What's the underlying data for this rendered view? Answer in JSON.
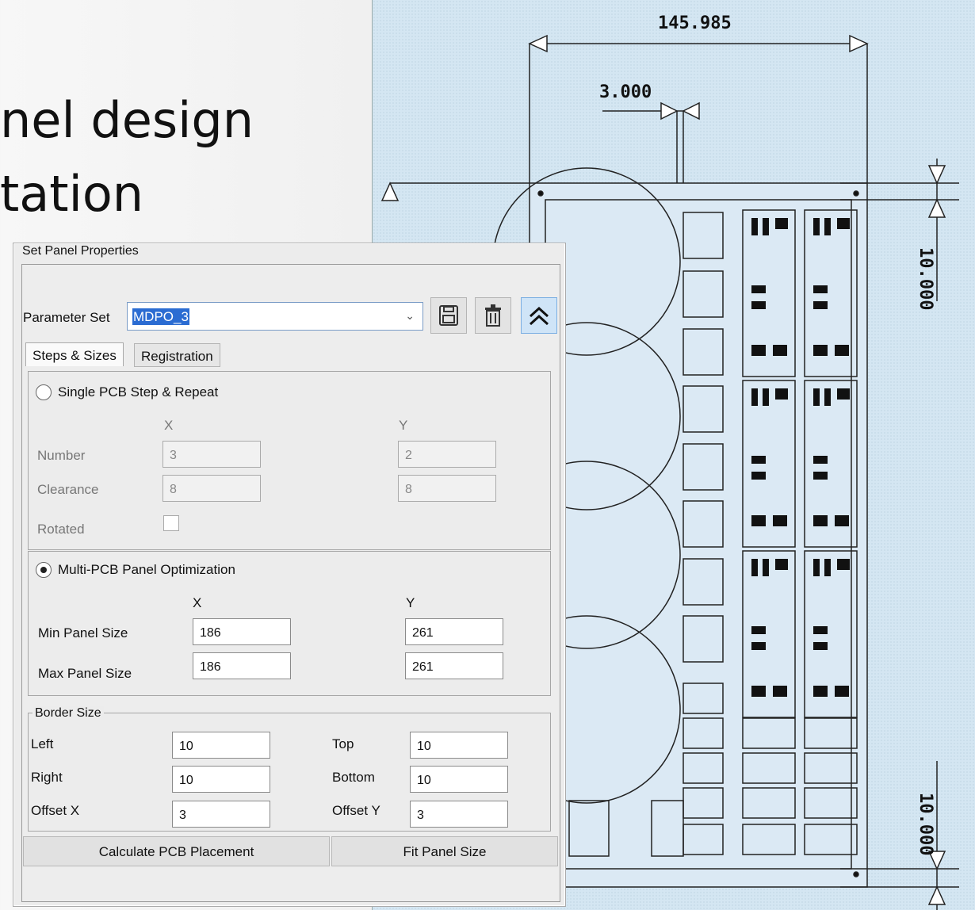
{
  "slide": {
    "title_line1": "nel design",
    "title_line2": "tation"
  },
  "drawing": {
    "dim_width": "145.985",
    "dim_gap": "3.000",
    "dim_border_top": "10.000",
    "dim_border_bottom": "10.000"
  },
  "dialog": {
    "group_title": "Set Panel Properties",
    "parameter_set_label": "Parameter Set",
    "parameter_set_value": "MDPO_3",
    "icons": {
      "save": "save-icon",
      "delete": "trash-icon",
      "collapse": "double-chevron-up-icon"
    },
    "tabs": [
      {
        "label": "Steps & Sizes",
        "selected": true
      },
      {
        "label": "Registration",
        "selected": false
      }
    ],
    "single": {
      "radio_label": "Single PCB Step & Repeat",
      "col_x": "X",
      "col_y": "Y",
      "number_label": "Number",
      "number_x": "3",
      "number_y": "2",
      "clearance_label": "Clearance",
      "clearance_x": "8",
      "clearance_y": "8",
      "rotated_label": "Rotated"
    },
    "multi": {
      "radio_label": "Multi-PCB Panel Optimization",
      "col_x": "X",
      "col_y": "Y",
      "min_label": "Min Panel Size",
      "min_x": "186",
      "min_y": "261",
      "max_label": "Max Panel Size",
      "max_x": "186",
      "max_y": "261"
    },
    "border": {
      "title": "Border Size",
      "left_label": "Left",
      "left": "10",
      "top_label": "Top",
      "top": "10",
      "right_label": "Right",
      "right": "10",
      "bottom_label": "Bottom",
      "bottom": "10",
      "offx_label": "Offset X",
      "offx": "3",
      "offy_label": "Offset Y",
      "offy": "3"
    },
    "buttons": {
      "calculate": "Calculate PCB Placement",
      "fit": "Fit Panel Size"
    }
  }
}
